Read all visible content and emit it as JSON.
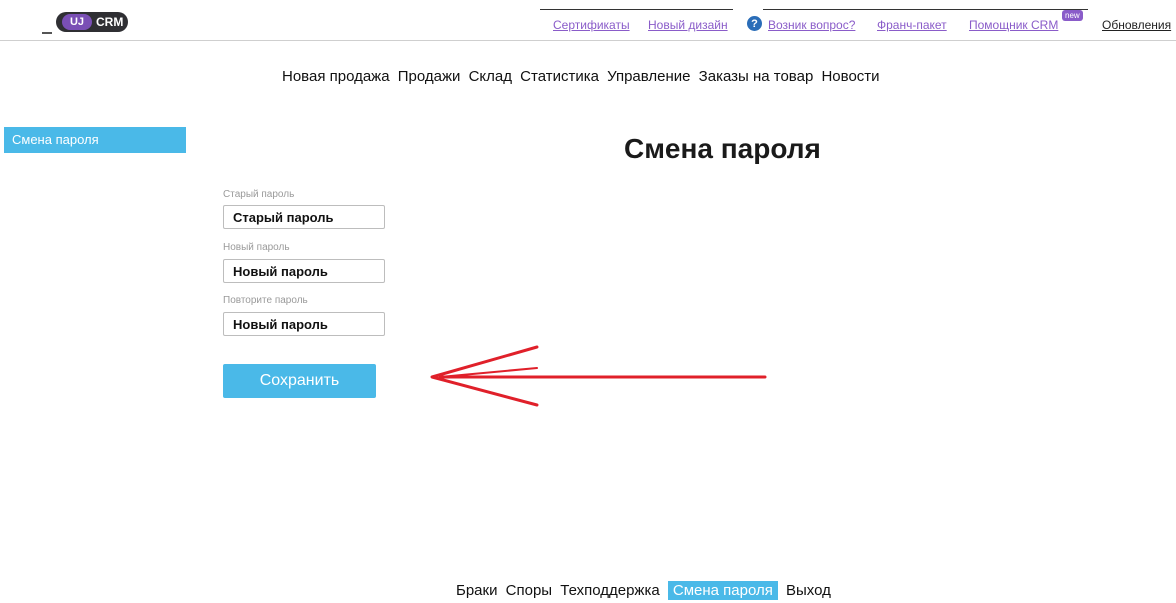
{
  "logo": {
    "text": "CRM",
    "mark": "UJ"
  },
  "topbar": {
    "links": [
      {
        "label": "Сертификаты"
      },
      {
        "label": "Новый дизайн"
      },
      {
        "label": "Возник вопрос?"
      },
      {
        "label": "Франч-пакет"
      },
      {
        "label": "Помощник CRM"
      }
    ],
    "help_icon": "question-circle-icon",
    "new_badge": "new",
    "updates": "Обновления"
  },
  "mainnav": [
    {
      "label": "Новая продажа"
    },
    {
      "label": "Продажи"
    },
    {
      "label": "Склад"
    },
    {
      "label": "Статистика"
    },
    {
      "label": "Управление"
    },
    {
      "label": "Заказы на товар"
    },
    {
      "label": "Новости"
    }
  ],
  "sidebar": {
    "items": [
      {
        "label": "Смена пароля"
      }
    ]
  },
  "page": {
    "title": "Смена пароля"
  },
  "form": {
    "old_password": {
      "label": "Старый пароль",
      "placeholder": "Старый пароль"
    },
    "new_password": {
      "label": "Новый пароль",
      "placeholder": "Новый пароль"
    },
    "repeat_password": {
      "label": "Повторите пароль",
      "placeholder": "Новый пароль"
    },
    "save_label": "Сохранить"
  },
  "bottomnav": [
    {
      "label": "Браки"
    },
    {
      "label": "Споры"
    },
    {
      "label": "Техподдержка"
    },
    {
      "label": "Смена пароля",
      "active": true
    },
    {
      "label": "Выход"
    }
  ],
  "colors": {
    "accent": "#4ab9e8",
    "link": "#8a5cc9",
    "annotation": "#e0202a"
  }
}
